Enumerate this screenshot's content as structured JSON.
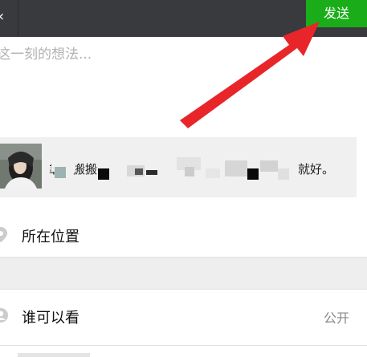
{
  "top_bar": {
    "send_label": "发送"
  },
  "composer": {
    "placeholder": "这一刻的想法..."
  },
  "link_card": {
    "visible_text_start": "靠！搬搬",
    "visible_text_end": "就好。"
  },
  "rows": {
    "location_label": "所在位置",
    "visibility_label": "谁可以看",
    "visibility_value": "公开"
  },
  "colors": {
    "top_bar": "#393a3e",
    "send_button": "#1aad19",
    "annotation_arrow": "#e8262a",
    "placeholder": "#b2b2b2"
  },
  "icons": {
    "location": "location-pin-icon",
    "visibility": "person-icon"
  }
}
